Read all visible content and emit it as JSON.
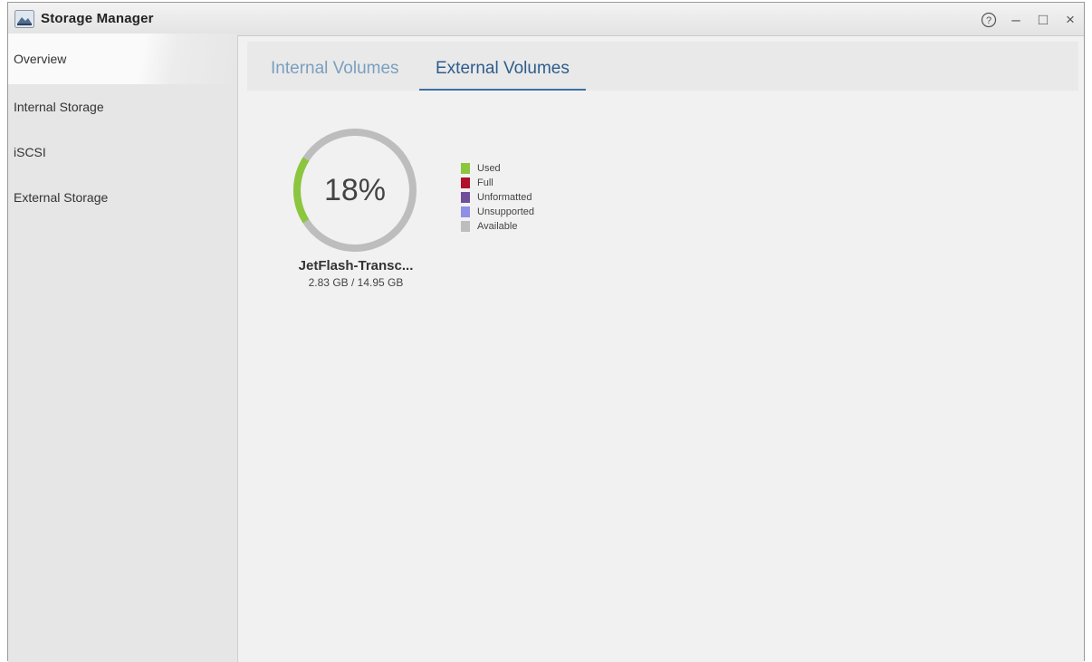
{
  "window": {
    "title": "Storage Manager",
    "controls": {
      "help": "?",
      "minimize": "–",
      "maximize": "□",
      "close": "×"
    }
  },
  "sidebar": {
    "items": [
      {
        "label": "Overview",
        "active": true
      },
      {
        "label": "Internal Storage",
        "active": false
      },
      {
        "label": "iSCSI",
        "active": false
      },
      {
        "label": "External Storage",
        "active": false
      }
    ]
  },
  "tabs": [
    {
      "label": "Internal Volumes",
      "active": false
    },
    {
      "label": "External Volumes",
      "active": true
    }
  ],
  "volume": {
    "percent_text": "18%",
    "used_fraction": 0.18,
    "name": "JetFlash-Transc...",
    "size": "2.83 GB / 14.95 GB"
  },
  "legend": [
    {
      "label": "Used",
      "color": "#8cc63f"
    },
    {
      "label": "Full",
      "color": "#b0102a"
    },
    {
      "label": "Unformatted",
      "color": "#6f4f9a"
    },
    {
      "label": "Unsupported",
      "color": "#8f8fe6"
    },
    {
      "label": "Available",
      "color": "#bdbdbd"
    }
  ],
  "colors": {
    "used": "#8cc63f",
    "available": "#bdbdbd",
    "tab_active": "#2e5d8c",
    "tab_inactive": "#7a9fc0"
  }
}
